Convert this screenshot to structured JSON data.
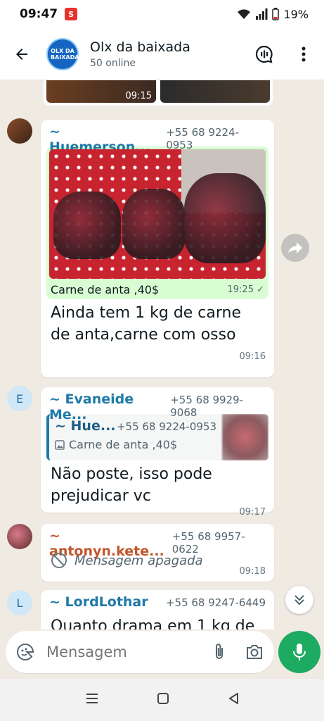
{
  "status_bar": {
    "time": "09:47",
    "battery": "19%"
  },
  "header": {
    "group_name": "Olx da baixada",
    "online": "50 online",
    "avatar_text": "OLX DA BAIXADA"
  },
  "top_images": {
    "time": "09:15"
  },
  "messages": [
    {
      "sender": "~ Huemerson...",
      "phone": "+55 68 9224-0953",
      "sender_color": "#1f7aa8",
      "image_caption": "Carne de anta ,40$",
      "image_time": "19:25",
      "text": "Ainda tem 1 kg de carne de anta,carne com osso",
      "time": "09:16"
    },
    {
      "avatar_letter": "E",
      "sender": "~ Evaneide Me...",
      "phone": "+55 68 9929-9068",
      "sender_color": "#1f7aa8",
      "quote_name": "~ Hue...",
      "quote_phone": "+55 68 9224-0953",
      "quote_text": "Carne de anta ,40$",
      "text": "Não poste, isso pode prejudicar vc",
      "time": "09:17"
    },
    {
      "sender": "~ antonyn.kete...",
      "phone": "+55 68 9957-0622",
      "sender_color": "#c2562c",
      "text": "Mensagem apagada",
      "time": "09:18"
    },
    {
      "avatar_letter": "L",
      "sender": "~ LordLothar",
      "phone": "+55 68 9247-6449",
      "sender_color": "#1f7aa8",
      "text": "Quanto drama em 1 kg de"
    }
  ],
  "composer": {
    "placeholder": "Mensagem"
  }
}
